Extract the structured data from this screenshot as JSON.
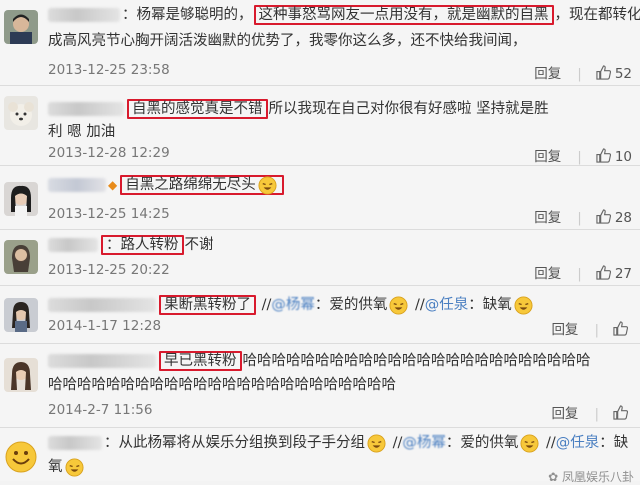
{
  "comments": [
    {
      "time": "2013-12-25 23:58",
      "reply": "回复",
      "likes": "52",
      "line1_pre": "：杨幂是够聪明的，",
      "line1_hl": "这种事怒骂网友一点用没有，就是幽默的自黑",
      "line1_post": "，现在都转化",
      "line2": "成高风亮节心胸开阔活泼幽默的优势了，我零你这么多，还不快给我间闻，"
    },
    {
      "time": "2013-12-28 12:29",
      "reply": "回复",
      "likes": "10",
      "line1_hl": "自黑的感觉真是不错",
      "line1_post": "所以我现在自己对你很有好感啦 坚持就是胜",
      "line2": "利 嗯 加油"
    },
    {
      "time": "2013-12-25 14:25",
      "reply": "回复",
      "likes": "28",
      "line1_hl": "自黑之路绵绵无尽头"
    },
    {
      "time": "2013-12-25 20:22",
      "reply": "回复",
      "likes": "27",
      "line1_hl": "：路人转粉",
      "line1_post": "不谢"
    },
    {
      "time": "2014-1-17 12:28",
      "reply": "回复",
      "likes": "",
      "line1_hl": "果断黑转粉了",
      "line1_sep1": " //",
      "line1_mention1": "@杨幂",
      "line1_post1": "：爱的供氧",
      "line1_sep2": " //",
      "line1_mention2": "@任泉",
      "line1_post2": "：缺氧"
    },
    {
      "time": "2014-2-7 11:56",
      "reply": "回复",
      "likes": "",
      "line1_hl": "早已黑转粉",
      "line1_post": "哈哈哈哈哈哈哈哈哈哈哈哈哈哈哈哈哈哈哈哈哈哈哈哈",
      "line2": "哈哈哈哈哈哈哈哈哈哈哈哈哈哈哈哈哈哈哈哈哈哈哈哈"
    },
    {
      "line1_pre": "：从此杨幂将从娱乐分组换到段子手分组",
      "line1_sep1": " //",
      "line1_mention1": "@杨幂",
      "line1_post1": "：爱的供氧",
      "line1_sep2": " //",
      "line1_mention2": "@任泉",
      "line1_post2": "：缺",
      "line2": "氧"
    }
  ],
  "watermark": "凤凰娱乐八卦",
  "colors": {
    "highlight": "#d81a2d",
    "mention": "#4a7fc1",
    "verified": "#e88b1a"
  }
}
